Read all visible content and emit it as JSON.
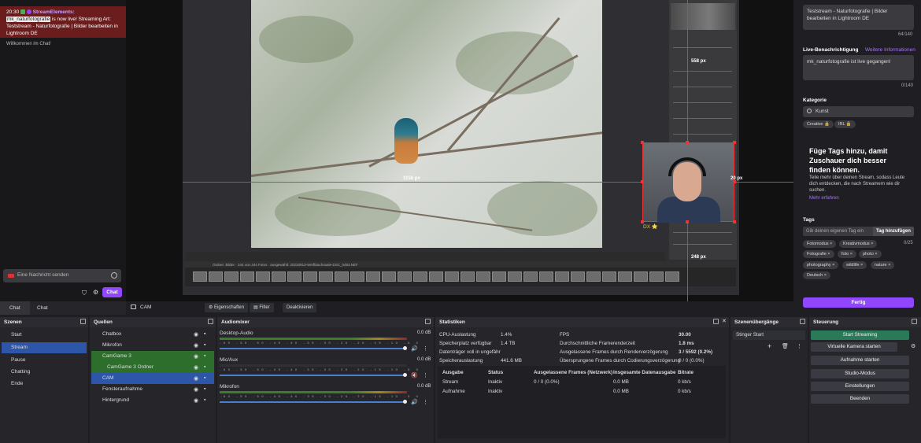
{
  "chat": {
    "time": "20:30",
    "sender": "StreamElements:",
    "highlight": "mk_naturfotografie",
    "message": " is now live! Streaming Art: Teststream - Naturfotografie | Bilder bearbeiten in Lightroom DE",
    "welcome": "Willkommen im Chat!",
    "input_placeholder": "Eine Nachricht senden",
    "chat_button": "Chat",
    "tabs": [
      "Chat",
      "Chat"
    ]
  },
  "preview": {
    "measure_top": "558 px",
    "measure_left": "1158 px",
    "measure_right": "20 px",
    "measure_bottom": "248 px",
    "dx_label": "DX ⭐",
    "filmstrip_info": "Ordner: Bilder · 344 von 344 Fotos · ausgewählt: 20230813-Weißbachsaale-DSC_0493.NEF"
  },
  "source_toolbar": {
    "source_name": "CAM",
    "properties": "Eigenschaften",
    "filter": "Filter",
    "deactivate": "Deaktivieren"
  },
  "right_panel": {
    "title_value": "Teststream - Naturfotografie | Bilder bearbeiten in Lightroom DE",
    "title_count": "64/140",
    "notification_label": "Live-Benachrichtigung",
    "notification_link": "Weitere Informationen",
    "notification_value": "mk_naturfotografie ist live gegangen!",
    "notification_count": "0/140",
    "category_label": "Kategorie",
    "category_value": "Kunst",
    "category_tags": [
      "Creative 🔒",
      "IRL 🔒"
    ],
    "tags_heading": "Füge Tags hinzu, damit Zuschauer dich besser finden können.",
    "tags_desc": "Teile mehr über deinen Stream, sodass Leute dich entdecken, die nach Streamern wie dir suchen.",
    "tags_more": "Mehr erfahren",
    "tags_label": "Tags",
    "tags_placeholder": "Gib deinen eigenen Tag ein",
    "tags_add": "Tag hinzufügen",
    "tags_count": "0/25",
    "tags": [
      "Fotomodus ×",
      "Kreativmodus ×",
      "Fotografie ×",
      "foto ×",
      "photo ×",
      "photography ×",
      "wildlife ×",
      "nature ×",
      "Deutsch ×"
    ],
    "done": "Fertig"
  },
  "scenes": {
    "title": "Szenen",
    "items": [
      "Start",
      "Stream",
      "Pause",
      "Chatting",
      "Ende"
    ],
    "selected": "Stream"
  },
  "sources": {
    "title": "Quellen",
    "items": [
      "Chatbox",
      "Mikrofon",
      "CamGame 3",
      "CamGame 3 Ordner",
      "CAM",
      "Fensteraufnahme",
      "Hintergrund"
    ]
  },
  "mixer": {
    "title": "Audiomixer",
    "scale": "-60 -55 -50 -45 -40 -35 -30 -25 -20 -15 -10 -5 0",
    "channels": [
      {
        "name": "Desktop-Audio",
        "db": "0.0 dB",
        "level": 0.62
      },
      {
        "name": "Mic/Aux",
        "db": "0.0 dB",
        "level": 0.0
      },
      {
        "name": "Mikrofon",
        "db": "0.0 dB",
        "level": 0.78
      }
    ]
  },
  "stats": {
    "title": "Statistiken",
    "left": [
      {
        "label": "CPU-Auslastung",
        "value": "1.4%"
      },
      {
        "label": "Speicherplatz verfügbar",
        "value": "1.4 TB"
      },
      {
        "label": "Datenträger voll in ungefähr",
        "value": ""
      },
      {
        "label": "Speicherauslastung",
        "value": "441.6 MB"
      }
    ],
    "right": [
      {
        "label": "FPS",
        "value": "30.00"
      },
      {
        "label": "Durchschnittliche Framerenderzeit",
        "value": "1.8 ms"
      },
      {
        "label": "Ausgelassene Frames durch Renderverzögerung",
        "value": "3 / 5592 (0.2%)"
      },
      {
        "label": "Übersprungene Frames durch Codierungsverzögerung",
        "value": "0 / 0 (0.0%)"
      }
    ],
    "table_headers": [
      "Ausgabe",
      "Status",
      "Ausgelassene Frames (Netzwerk)",
      "Insgesamte Datenausgabe",
      "Bitrate"
    ],
    "table_rows": [
      [
        "Stream",
        "Inaktiv",
        "0 / 0 (0.0%)",
        "0.0 MB",
        "0 kb/s"
      ],
      [
        "Aufnahme",
        "Inaktiv",
        "",
        "0.0 MB",
        "0 kb/s"
      ]
    ]
  },
  "transitions": {
    "title": "Szenenübergänge",
    "selected": "Stinger Start"
  },
  "controls": {
    "title": "Steuerung",
    "start_streaming": "Start Streaming",
    "virtual_cam": "Virtuelle Kamera starten",
    "record": "Aufnahme starten",
    "studio": "Studio-Modus",
    "settings": "Einstellungen",
    "exit": "Beenden"
  },
  "colors": {
    "accent": "#9147ff",
    "scene_selected": "#2d55a8",
    "streaming_button": "#2a7a5a"
  }
}
